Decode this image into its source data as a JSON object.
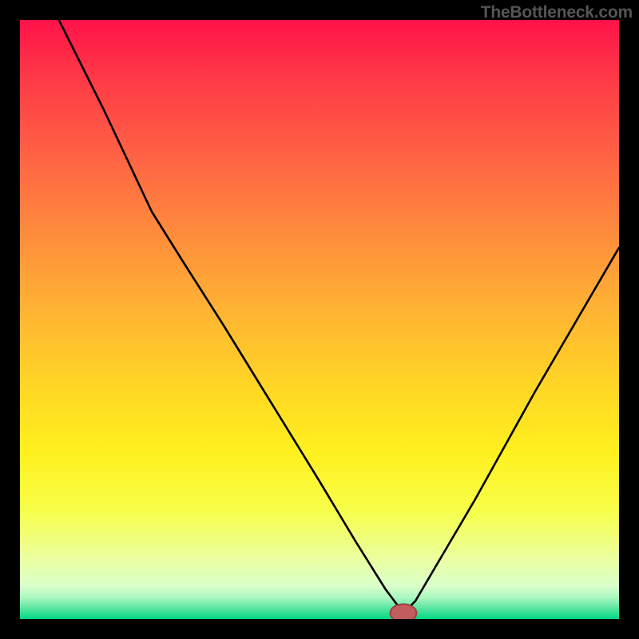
{
  "watermark": "TheBottleneck.com",
  "colors": {
    "frame": "#000000",
    "watermark": "#555555",
    "curve": "#000000",
    "marker_fill": "#c15d5d",
    "marker_stroke": "#9b4040",
    "gradient_stops": [
      {
        "offset": 0.0,
        "color": "#ff1248"
      },
      {
        "offset": 0.1,
        "color": "#ff3b47"
      },
      {
        "offset": 0.22,
        "color": "#ff6044"
      },
      {
        "offset": 0.35,
        "color": "#ff8a3d"
      },
      {
        "offset": 0.48,
        "color": "#ffb233"
      },
      {
        "offset": 0.6,
        "color": "#ffd326"
      },
      {
        "offset": 0.72,
        "color": "#fff01e"
      },
      {
        "offset": 0.82,
        "color": "#f7ff4a"
      },
      {
        "offset": 0.9,
        "color": "#eaffa0"
      },
      {
        "offset": 0.945,
        "color": "#d9ffca"
      },
      {
        "offset": 0.965,
        "color": "#a8f7bf"
      },
      {
        "offset": 0.985,
        "color": "#4be39b"
      },
      {
        "offset": 1.0,
        "color": "#00d884"
      }
    ]
  },
  "chart_data": {
    "type": "line",
    "title": "",
    "xlabel": "",
    "ylabel": "",
    "xlim": [
      0,
      100
    ],
    "ylim": [
      0,
      100
    ],
    "grid": false,
    "legend": false,
    "notes": "Bottleneck-style curve. Background is a vertical red→orange→yellow→green gradient. Single black curve with a V-shaped minimum; small rounded marker at the minimum.",
    "series": [
      {
        "name": "bottleneck-curve",
        "x": [
          6.5,
          14,
          22,
          27,
          34,
          42,
          50,
          56,
          61,
          64,
          66,
          76,
          86,
          100
        ],
        "y": [
          100,
          85,
          68,
          60,
          49,
          36,
          23,
          13,
          5,
          1,
          3,
          20,
          38,
          62
        ]
      }
    ],
    "marker": {
      "x": 64,
      "y": 1,
      "rx": 2.2,
      "ry": 1.5
    }
  }
}
